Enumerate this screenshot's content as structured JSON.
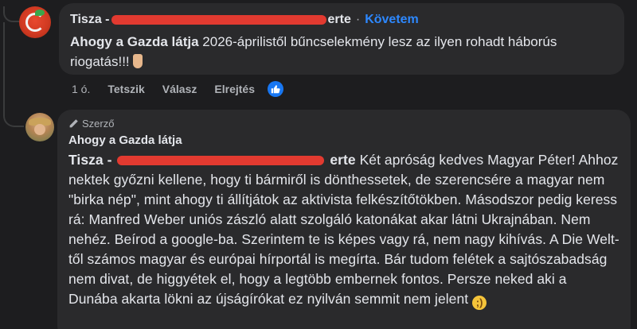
{
  "comment1": {
    "author_prefix": "Tisza -",
    "author_suffix": "erte",
    "follow_label": "Követem",
    "mention": "Ahogy a Gazda látja",
    "text": "2026-áprilistől bűncselekmény lesz az ilyen rohadt háborús riogatás!!!",
    "time": "1 ó.",
    "like_label": "Tetszik",
    "reply_label": "Válasz",
    "hide_label": "Elrejtés"
  },
  "comment2": {
    "badge_label": "Szerző",
    "author": "Ahogy a Gazda látja",
    "mention_prefix": "Tisza -",
    "mention_suffix": "erte",
    "text": "Két apróság kedves Magyar Péter! Ahhoz nektek győzni kellene, hogy ti bármiről is dönthessetek, de szerencsére a magyar nem \"birka nép\", mint ahogy ti állítjátok az aktivista felkészítőtökben. Másodszor pedig keress rá: Manfred Weber uniós zászló alatt szolgáló katonákat akar látni Ukrajnában. Nem nehéz. Beírod a google-ba. Szerintem te is képes vagy rá, nem nagy kihívás. A Die Welt-től számos magyar és európai hírportál is megírta. Bár tudom felétek a sajtószabadság nem divat, de higgyétek el, hogy a legtöbb embernek fontos. Persze neked aki a Dunába akarta lökni az újságírókat ez nyilván semmit nem jelent"
  },
  "colors": {
    "background": "#1d1d1f",
    "bubble": "#2a2a2c",
    "link_blue": "#2d88ff",
    "redaction": "#e23a30"
  }
}
